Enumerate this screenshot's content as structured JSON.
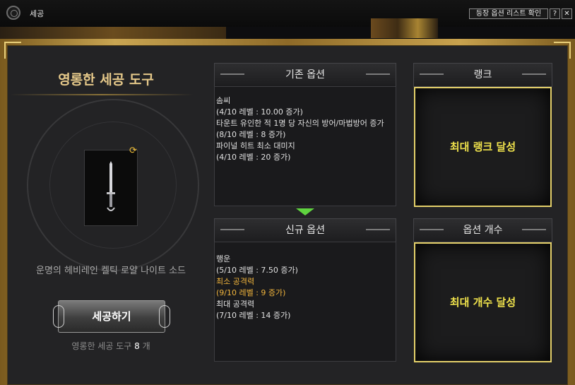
{
  "window": {
    "title": "세공",
    "icon": "search-icon"
  },
  "toolbar": {
    "list_button": "등장 옵션 리스트 확인",
    "help": "?",
    "close": "✕"
  },
  "left": {
    "title": "영롱한 세공 도구",
    "item_name": "운명의 헤비레인 켈틱 로얄 나이트 소드",
    "refine_button": "세공하기",
    "count_label": "영롱한 세공 도구",
    "count_value": "8",
    "count_unit": "개"
  },
  "existing": {
    "header": "기존 옵션",
    "lines": [
      {
        "text": "솜씨",
        "highlight": false
      },
      {
        "text": "(4/10 레벨 : 10.00 증가)",
        "highlight": false
      },
      {
        "text": "타운트 유인한 적 1명 당 자신의 방어/마법방어 증가",
        "highlight": false
      },
      {
        "text": "(8/10 레벨 : 8 증가)",
        "highlight": false
      },
      {
        "text": "파이널 히트 최소 대미지",
        "highlight": false
      },
      {
        "text": "(4/10 레벨 : 20 증가)",
        "highlight": false
      }
    ]
  },
  "newopt": {
    "header": "신규 옵션",
    "lines": [
      {
        "text": "행운",
        "highlight": false
      },
      {
        "text": "(5/10 레벨 : 7.50 증가)",
        "highlight": false
      },
      {
        "text": "최소 공격력",
        "highlight": true
      },
      {
        "text": "(9/10 레벨 : 9 증가)",
        "highlight": true
      },
      {
        "text": "최대 공격력",
        "highlight": false
      },
      {
        "text": "(7/10 레벨 : 14 증가)",
        "highlight": false
      }
    ]
  },
  "rank": {
    "header": "랭크",
    "status": "최대 랭크 달성"
  },
  "option_count": {
    "header": "옵션 개수",
    "status": "최대 개수 달성"
  },
  "colors": {
    "gold": "#f0b43c",
    "yellow_status": "#f0e34c",
    "arrow": "#5fd33f",
    "frame": "#c9a552"
  }
}
